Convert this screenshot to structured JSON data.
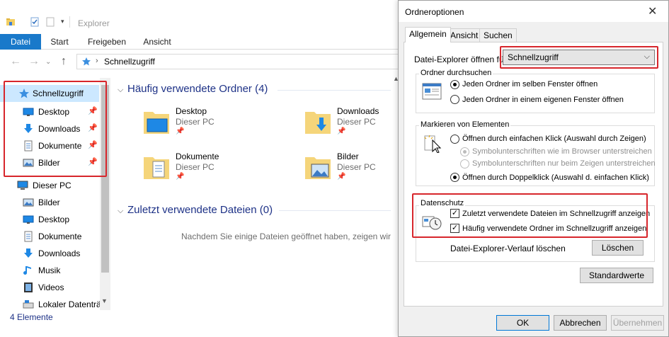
{
  "explorer": {
    "title": "Explorer",
    "ribbon_tabs": [
      "Datei",
      "Start",
      "Freigeben",
      "Ansicht"
    ],
    "address_crumb": "Schnellzugriff",
    "nav": {
      "quick_access": "Schnellzugriff",
      "pinned": [
        {
          "label": "Desktop",
          "icon": "desktop-icon"
        },
        {
          "label": "Downloads",
          "icon": "downloads-icon"
        },
        {
          "label": "Dokumente",
          "icon": "documents-icon"
        },
        {
          "label": "Bilder",
          "icon": "pictures-icon"
        }
      ],
      "this_pc": "Dieser PC",
      "pc_items": [
        {
          "label": "Bilder",
          "icon": "pictures-icon"
        },
        {
          "label": "Desktop",
          "icon": "desktop-icon"
        },
        {
          "label": "Dokumente",
          "icon": "documents-icon"
        },
        {
          "label": "Downloads",
          "icon": "downloads-icon"
        },
        {
          "label": "Musik",
          "icon": "music-icon"
        },
        {
          "label": "Videos",
          "icon": "videos-icon"
        },
        {
          "label": "Lokaler Datenträ",
          "icon": "drive-icon"
        }
      ]
    },
    "frequent_header": "Häufig verwendete Ordner (4)",
    "frequent_folders": [
      {
        "name": "Desktop",
        "location": "Dieser PC"
      },
      {
        "name": "Downloads",
        "location": "Dieser PC"
      },
      {
        "name": "Dokumente",
        "location": "Dieser PC"
      },
      {
        "name": "Bilder",
        "location": "Dieser PC"
      }
    ],
    "recent_header": "Zuletzt verwendete Dateien (0)",
    "recent_empty": "Nachdem Sie einige Dateien geöffnet haben, zeigen wir hier",
    "status": "4 Elemente"
  },
  "dialog": {
    "title": "Ordneroptionen",
    "tabs": [
      "Allgemein",
      "Ansicht",
      "Suchen"
    ],
    "open_label": "Datei-Explorer öffnen für:",
    "open_value": "Schnellzugriff",
    "browse": {
      "label": "Ordner durchsuchen",
      "options": [
        "Jeden Ordner im selben Fenster öffnen",
        "Jeden Ordner in einem eigenen Fenster öffnen"
      ]
    },
    "click": {
      "label": "Markieren von Elementen",
      "single": "Öffnen durch einfachen Klick (Auswahl durch Zeigen)",
      "underline_browser": "Symbolunterschriften wie im Browser unterstreichen",
      "underline_hover": "Symbolunterschriften nur beim Zeigen unterstreichen",
      "double": "Öffnen durch Doppelklick (Auswahl d. einfachen Klick)"
    },
    "privacy": {
      "label": "Datenschutz",
      "recent_files": "Zuletzt verwendete Dateien im Schnellzugriff anzeigen",
      "frequent_folders": "Häufig verwendete Ordner im Schnellzugriff anzeigen",
      "clear_label": "Datei-Explorer-Verlauf löschen",
      "clear_button": "Löschen"
    },
    "defaults_button": "Standardwerte",
    "ok": "OK",
    "cancel": "Abbrechen",
    "apply": "Übernehmen"
  },
  "colors": {
    "accent": "#1979ca",
    "highlight_box": "#d7262c",
    "selection": "#cce8ff",
    "link_text": "#1e3287"
  }
}
